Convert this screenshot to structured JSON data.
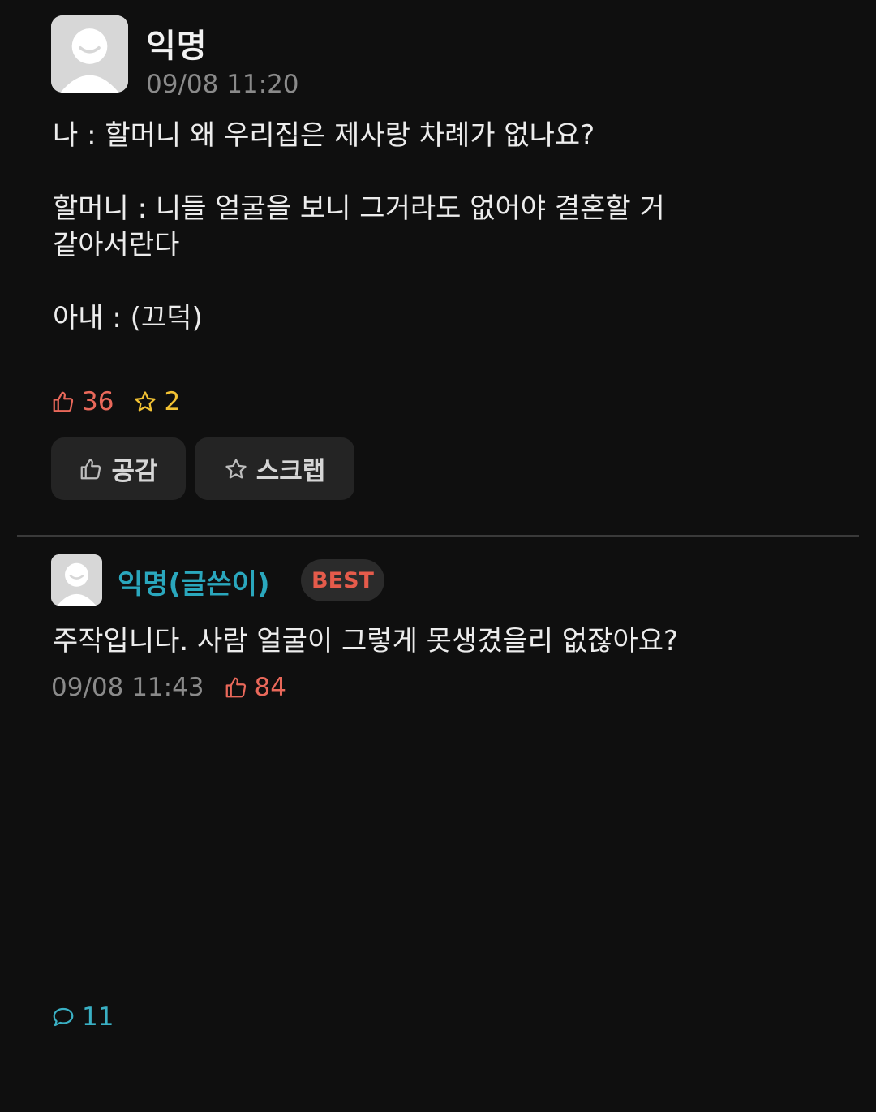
{
  "post": {
    "author": "익명",
    "time": "09/08 11:20",
    "body": {
      "line1": "나 : 할머니 왜 우리집은 제사랑 차례가 없나요?",
      "line2a": "할머니 : 니들 얼굴을 보니 그거라도 없어야 결혼할 거",
      "line2b": "같아서란다",
      "line3": "아내 : (끄덕)"
    },
    "stats": {
      "likes": "36",
      "comments": "11",
      "scraps": "2"
    },
    "actions": {
      "like_label": "공감",
      "scrap_label": "스크랩"
    }
  },
  "comment": {
    "author": "익명(글쓴이)",
    "badge": "BEST",
    "body": "주작입니다. 사람 얼굴이 그렇게 못생겼을리 없잖아요?",
    "time": "09/08 11:43",
    "likes": "84"
  },
  "colors": {
    "background": "#0f0f0f",
    "like": "#e9685a",
    "comment": "#3ab0c4",
    "scrap": "#f2c233",
    "author_highlight": "#2aa7bd",
    "best_badge": "#e55b4b"
  },
  "icons": {
    "avatar": "default-avatar-icon",
    "like": "thumbs-up-icon",
    "comment": "speech-bubble-icon",
    "scrap": "star-icon"
  }
}
